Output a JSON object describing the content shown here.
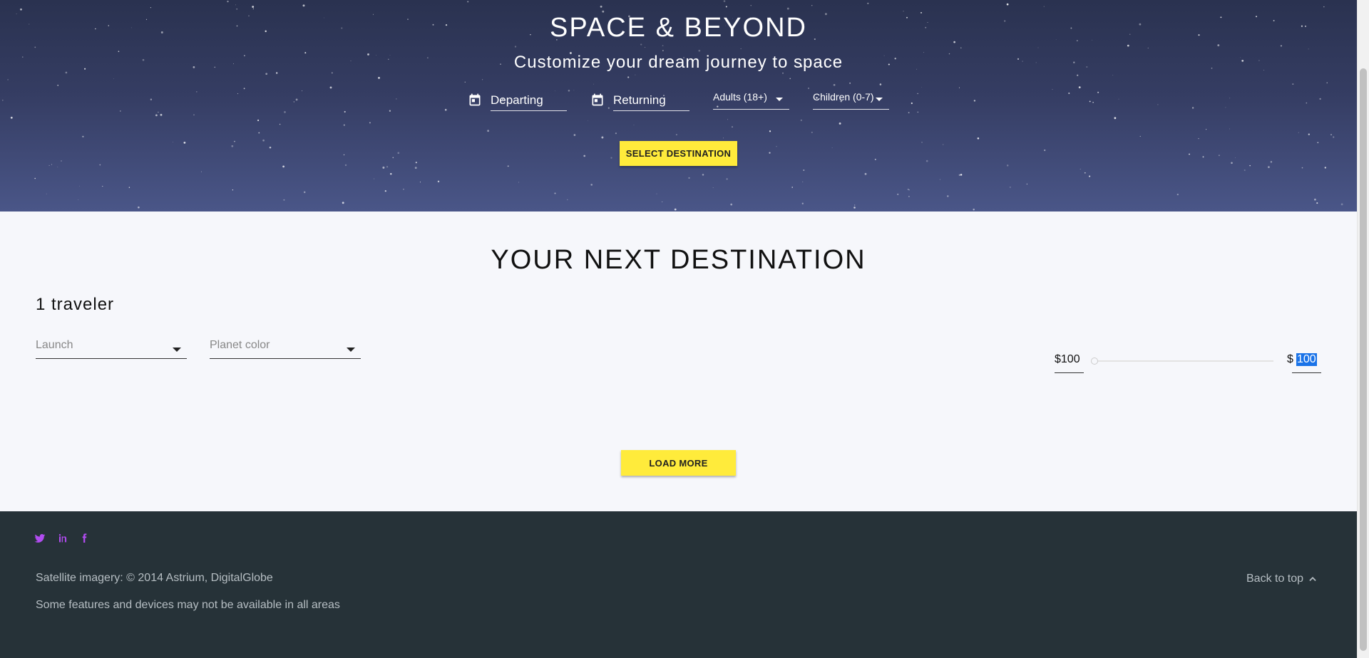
{
  "hero": {
    "title": "SPACE & BEYOND",
    "subtitle": "Customize your dream journey to space",
    "departing_label": "Departing",
    "returning_label": "Returning",
    "adults_label": "Adults (18+)",
    "children_label": "Children (0-7)",
    "select_destination_label": "SELECT DESTINATION"
  },
  "main": {
    "title": "YOUR NEXT DESTINATION",
    "traveler_count": "1 traveler",
    "launch_placeholder": "Launch",
    "planet_color_placeholder": "Planet color",
    "price_min": "$100",
    "price_currency": "$",
    "price_max": "100",
    "load_more_label": "LOAD MORE"
  },
  "footer": {
    "social": [
      "twitter-icon",
      "linkedin-icon",
      "facebook-icon"
    ],
    "line1": "Satellite imagery: © 2014 Astrium, DigitalGlobe",
    "line2": "Some features and devices may not be available in all areas",
    "back_to_top": "Back to top"
  },
  "colors": {
    "accent": "#ffeb3b",
    "footer_bg": "#263238",
    "social_icon": "#b14cf0",
    "selection": "#1a73e8"
  }
}
